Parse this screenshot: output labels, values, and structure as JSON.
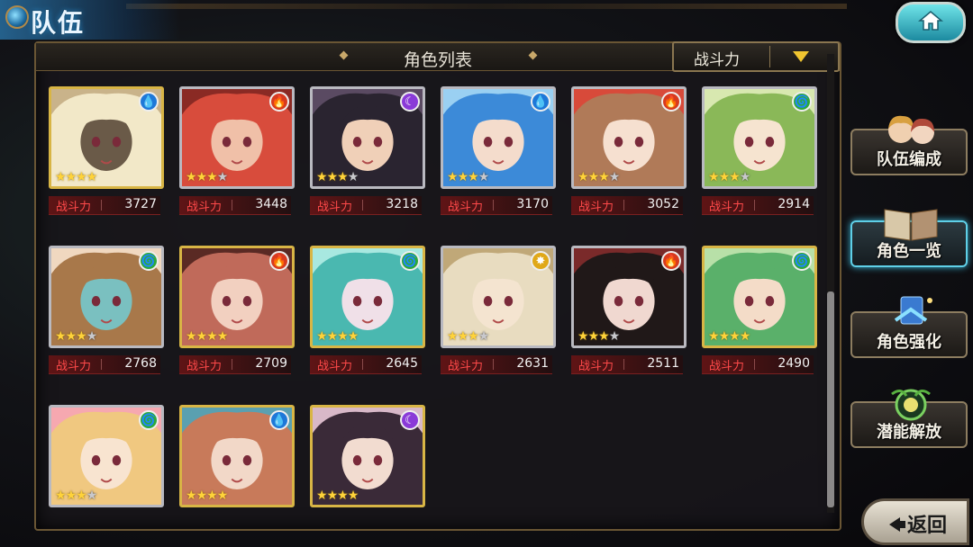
{
  "header": {
    "title": "队伍"
  },
  "panel": {
    "title": "角色列表",
    "sort_label": "战斗力"
  },
  "power_label": "战斗力",
  "characters": [
    {
      "element": "water",
      "stars": 4,
      "frame": "gold",
      "power": "3727",
      "palette": [
        "#f2e8c8",
        "#c9b38a",
        "#6a5a48"
      ]
    },
    {
      "element": "fire",
      "stars": 3,
      "frame": "silver",
      "power": "3448",
      "palette": [
        "#d84c3c",
        "#8a2a24",
        "#f0c0a8"
      ]
    },
    {
      "element": "dark",
      "stars": 3,
      "frame": "silver",
      "power": "3218",
      "palette": [
        "#2a2430",
        "#5a4a62",
        "#f0d0b8"
      ]
    },
    {
      "element": "water",
      "stars": 3,
      "frame": "silver",
      "power": "3170",
      "palette": [
        "#3c8ad8",
        "#9ad0f2",
        "#f4dccc"
      ]
    },
    {
      "element": "fire",
      "stars": 3,
      "frame": "silver",
      "power": "3052",
      "palette": [
        "#b07a58",
        "#d84a3a",
        "#f6e0d0"
      ]
    },
    {
      "element": "wind",
      "stars": 3,
      "frame": "silver",
      "power": "2914",
      "palette": [
        "#8ab858",
        "#d8e8b0",
        "#f6e4d0"
      ]
    },
    {
      "element": "wind",
      "stars": 3,
      "frame": "silver",
      "power": "2768",
      "palette": [
        "#a8784a",
        "#f0d8c0",
        "#7ac0c0"
      ]
    },
    {
      "element": "fire",
      "stars": 4,
      "frame": "gold",
      "power": "2709",
      "palette": [
        "#c06a5a",
        "#5a2a24",
        "#f2d0c0"
      ]
    },
    {
      "element": "wind",
      "stars": 4,
      "frame": "gold",
      "power": "2645",
      "palette": [
        "#4ab8b0",
        "#a8e8e0",
        "#f0e0e8"
      ]
    },
    {
      "element": "light",
      "stars": 3,
      "frame": "silver",
      "power": "2631",
      "palette": [
        "#e8dcc0",
        "#c0a878",
        "#f4e4d0"
      ]
    },
    {
      "element": "fire",
      "stars": 3,
      "frame": "silver",
      "power": "2511",
      "palette": [
        "#201818",
        "#7a2a2a",
        "#f0d8d0"
      ]
    },
    {
      "element": "wind",
      "stars": 4,
      "frame": "gold",
      "power": "2490",
      "palette": [
        "#5ab06a",
        "#b8e0a8",
        "#f4dcc8"
      ]
    },
    {
      "element": "wind",
      "stars": 3,
      "frame": "silver",
      "power": "",
      "palette": [
        "#f0c880",
        "#f6a8b0",
        "#f8e4d0"
      ]
    },
    {
      "element": "water",
      "stars": 4,
      "frame": "gold",
      "power": "",
      "palette": [
        "#c87a5a",
        "#5aa0b0",
        "#f2d8c8"
      ]
    },
    {
      "element": "dark",
      "stars": 4,
      "frame": "gold",
      "power": "",
      "palette": [
        "#3a2a38",
        "#d8b8c8",
        "#f2dcd0"
      ]
    }
  ],
  "menu": [
    {
      "id": "team-edit",
      "label": "队伍编成",
      "active": false
    },
    {
      "id": "char-list",
      "label": "角色一览",
      "active": true
    },
    {
      "id": "char-enhance",
      "label": "角色强化",
      "active": false
    },
    {
      "id": "potential",
      "label": "潜能解放",
      "active": false
    }
  ],
  "back": {
    "label": "返回"
  },
  "element_colors": {
    "water": "#1e78d8",
    "fire": "#d83a1e",
    "dark": "#8a3ad8",
    "wind": "#2ea83a",
    "light": "#e0a818"
  }
}
